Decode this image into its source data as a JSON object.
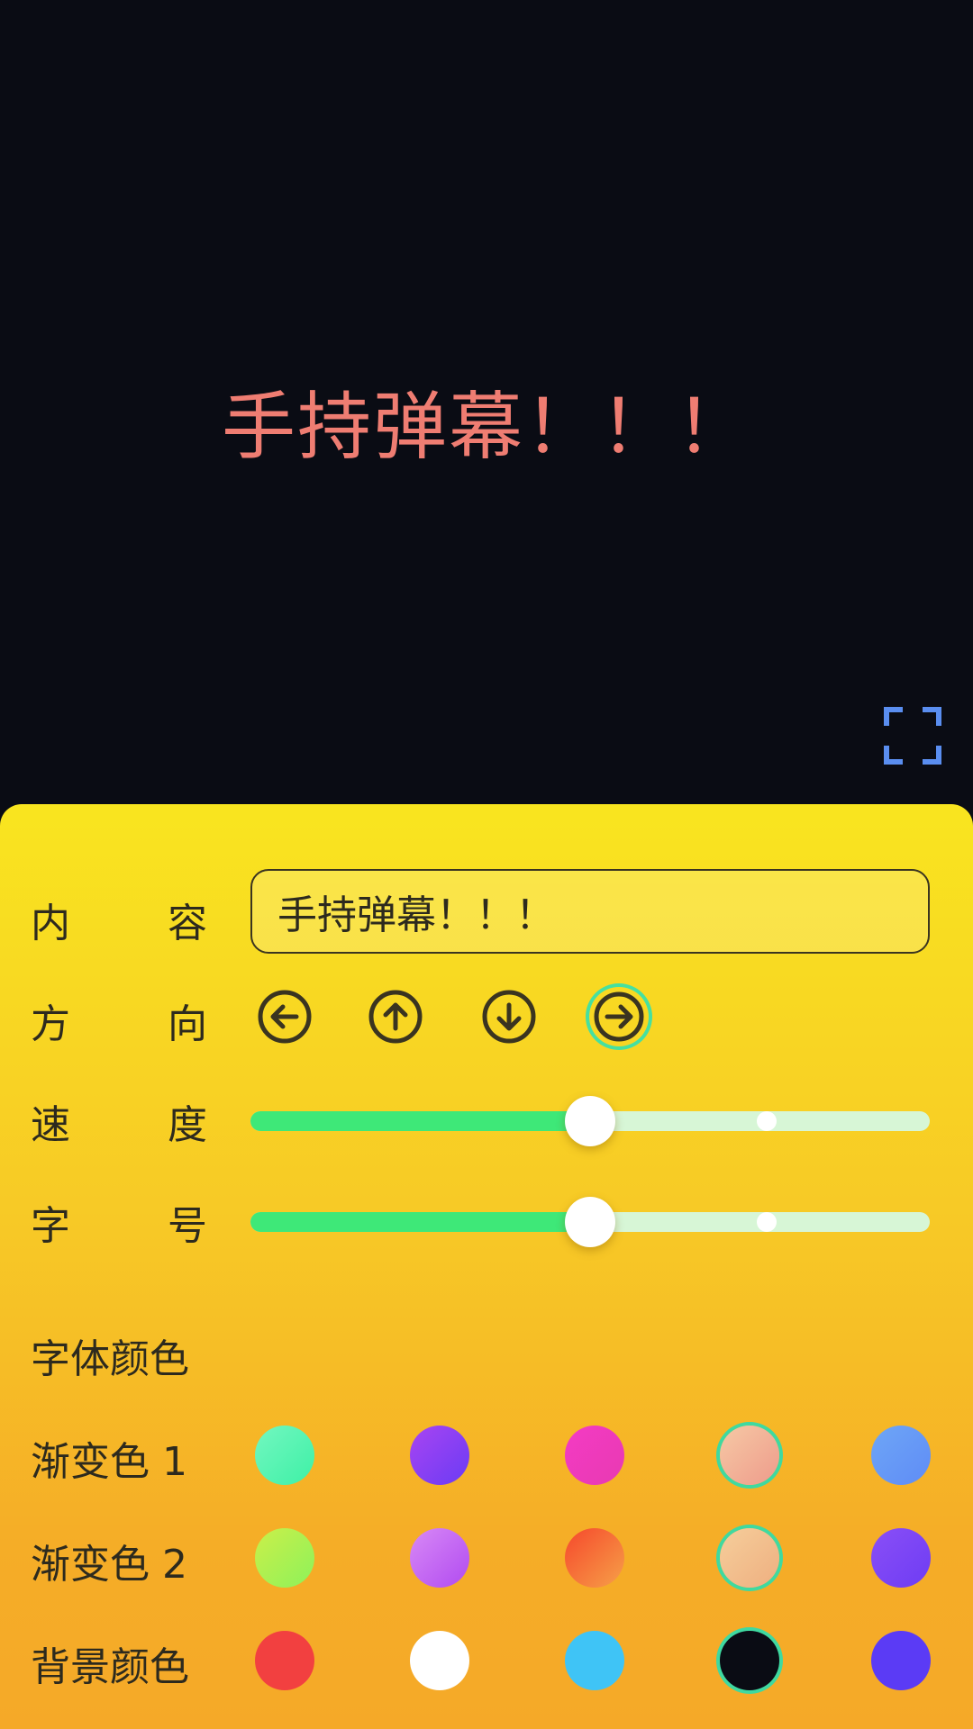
{
  "preview": {
    "text": "手持弹幕！！！",
    "text_color": "#ef7d72",
    "background": "#0a0c14",
    "fullscreen_icon": "fullscreen-icon"
  },
  "settings": {
    "content": {
      "label_chars": [
        "内",
        "容"
      ],
      "value": "手持弹幕！！！"
    },
    "direction": {
      "label_chars": [
        "方",
        "向"
      ],
      "options": [
        {
          "icon": "arrow-left-icon"
        },
        {
          "icon": "arrow-up-icon"
        },
        {
          "icon": "arrow-down-icon"
        },
        {
          "icon": "arrow-right-icon",
          "selected": true
        }
      ]
    },
    "speed": {
      "label_chars": [
        "速",
        "度"
      ],
      "value": 0.5,
      "buffer": 0.76
    },
    "font_size": {
      "label_chars": [
        "字",
        "号"
      ],
      "value": 0.5,
      "buffer": 0.76
    },
    "font_color": {
      "label": "字体颜色"
    },
    "gradient1": {
      "label": "渐变色 1",
      "swatches": [
        {
          "from": "#73f7c0",
          "to": "#3ef0a6"
        },
        {
          "from": "#a845f2",
          "to": "#6b3bf4"
        },
        {
          "from": "#f43bc4",
          "to": "#e83ab2"
        },
        {
          "from": "#f6c9a5",
          "to": "#ee9b8b",
          "selected": true
        },
        {
          "from": "#6ea6f5",
          "to": "#5f8cf7"
        }
      ]
    },
    "gradient2": {
      "label": "渐变色 2",
      "swatches": [
        {
          "from": "#cbef49",
          "to": "#8df25a"
        },
        {
          "from": "#d889f6",
          "to": "#b14bf0"
        },
        {
          "from": "#f5482c",
          "to": "#f7a048"
        },
        {
          "from": "#f6ce9b",
          "to": "#eeaf80",
          "selected": true
        },
        {
          "from": "#8a4ff6",
          "to": "#6e3cf4"
        }
      ]
    },
    "background": {
      "label": "背景颜色",
      "swatches": [
        {
          "color": "#f24040"
        },
        {
          "color": "#ffffff"
        },
        {
          "color": "#3fc4f6"
        },
        {
          "color": "#0a0c14",
          "selected": true
        },
        {
          "color": "#5b3bf5"
        }
      ]
    }
  }
}
